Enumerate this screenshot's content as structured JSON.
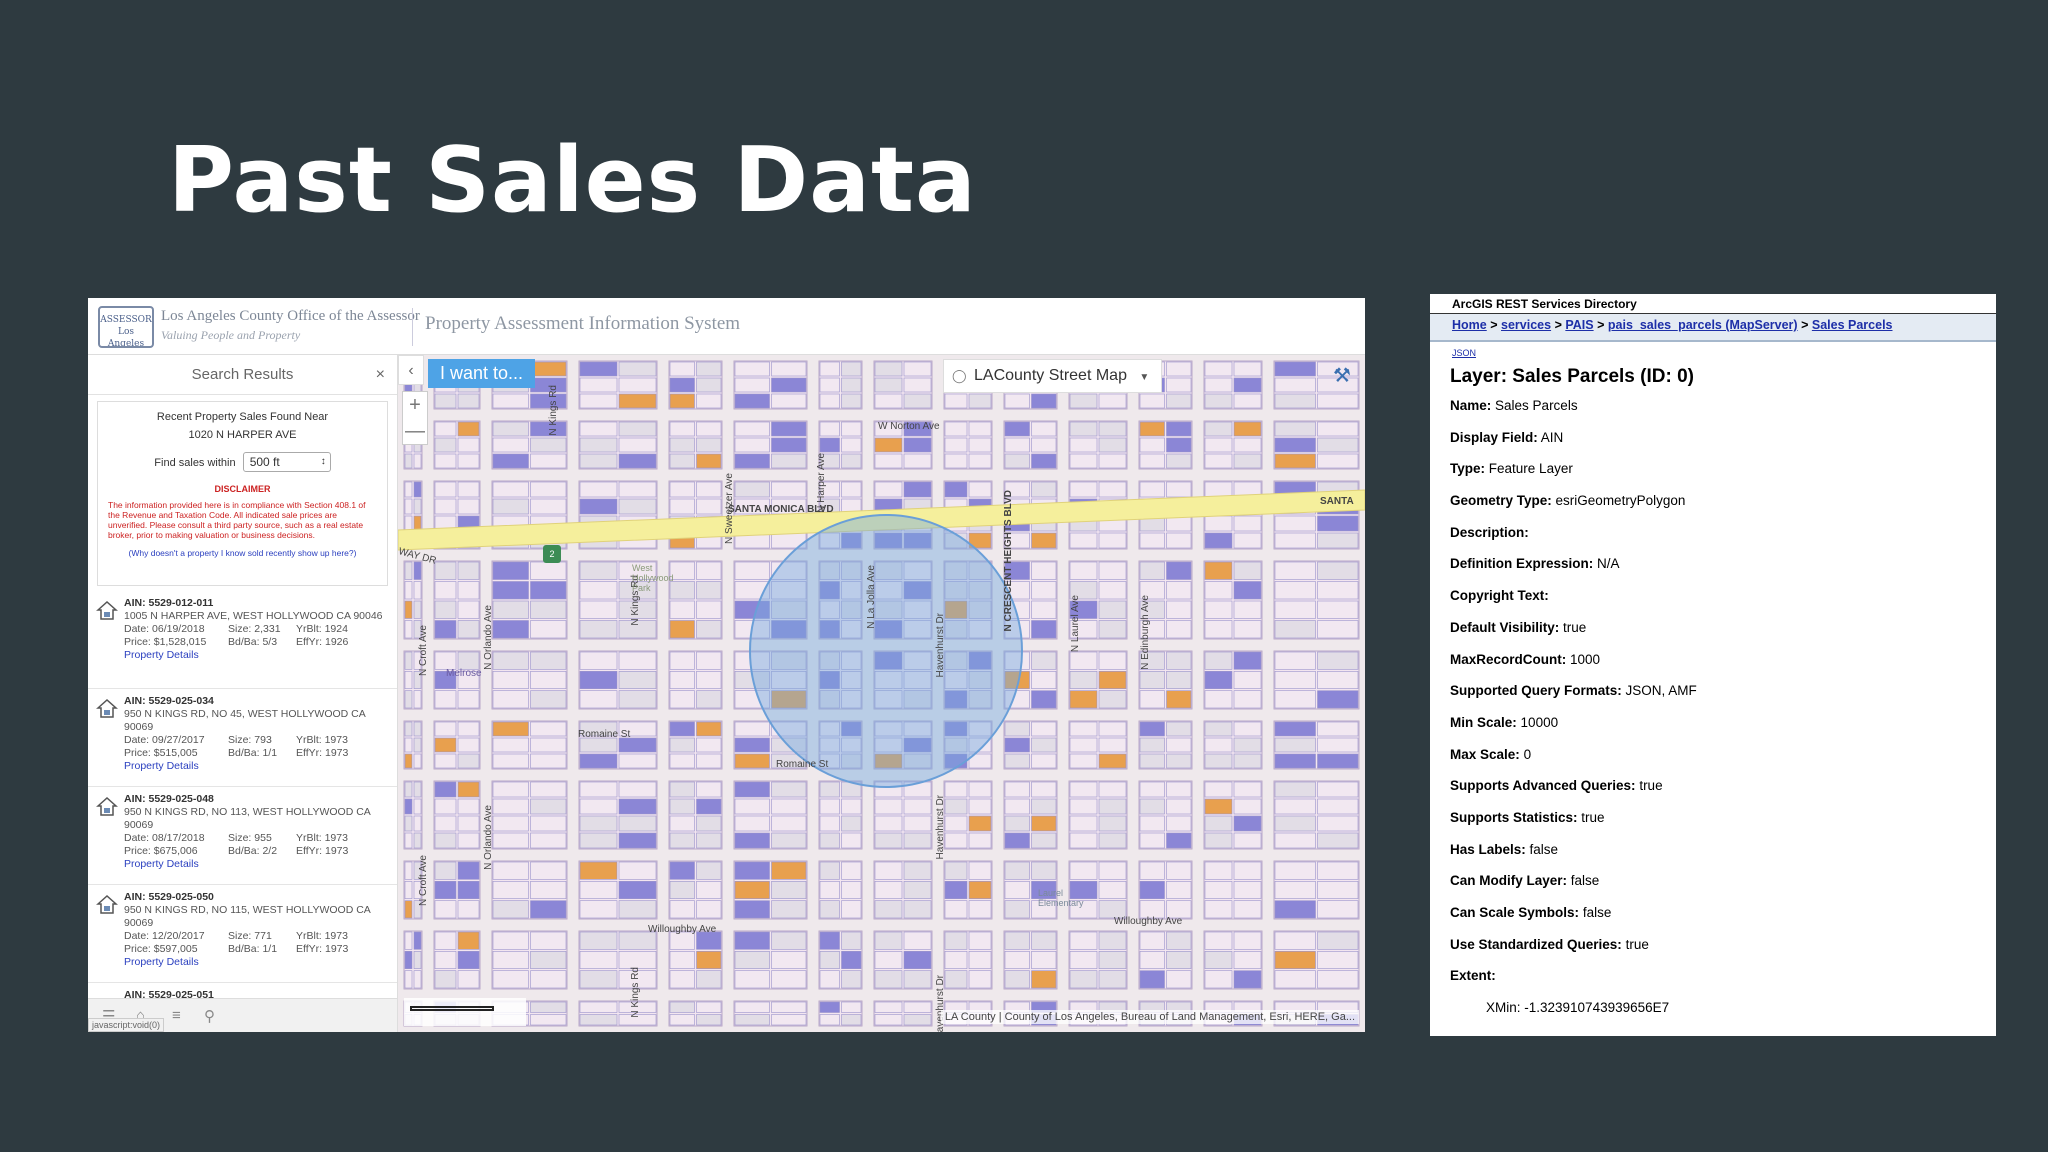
{
  "slide": {
    "title": "Past Sales Data"
  },
  "pais": {
    "logo_text": "ASSESSOR Los Angeles County",
    "office": "Los Angeles County Office of the Assessor",
    "tagline": "Valuing People and Property",
    "system_title": "Property Assessment Information System",
    "sidebar": {
      "title": "Search Results",
      "close_glyph": "×",
      "collapse_glyph": "‹",
      "recent_line1": "Recent Property Sales Found Near",
      "recent_line2": "1020 N HARPER AVE",
      "find_label": "Find sales within",
      "find_value": "500 ft",
      "disclaimer_heading": "DISCLAIMER",
      "disclaimer_text": "The information provided here is in compliance with Section 408.1 of the Revenue and Taxation Code. All indicated sale prices are unverified. Please consult a third party source, such as a real estate broker, prior to making valuation or business decisions.",
      "why_link": "(Why doesn't a property I know sold recently show up here?)",
      "results": [
        {
          "ain": "AIN: 5529-012-011",
          "address": "1005 N HARPER AVE, WEST HOLLYWOOD CA 90046",
          "date": "Date: 06/19/2018",
          "size": "Size: 2,331",
          "yrblt": "YrBlt: 1924",
          "price": "Price: $1,528,015",
          "bdba": "Bd/Ba: 5/3",
          "effyr": "EffYr: 1926",
          "link": "Property Details"
        },
        {
          "ain": "AIN: 5529-025-034",
          "address": "950 N KINGS RD, NO 45, WEST HOLLYWOOD CA 90069",
          "date": "Date: 09/27/2017",
          "size": "Size: 793",
          "yrblt": "YrBlt: 1973",
          "price": "Price: $515,005",
          "bdba": "Bd/Ba: 1/1",
          "effyr": "EffYr: 1973",
          "link": "Property Details"
        },
        {
          "ain": "AIN: 5529-025-048",
          "address": "950 N KINGS RD, NO 113, WEST HOLLYWOOD CA 90069",
          "date": "Date: 08/17/2018",
          "size": "Size: 955",
          "yrblt": "YrBlt: 1973",
          "price": "Price: $675,006",
          "bdba": "Bd/Ba: 2/2",
          "effyr": "EffYr: 1973",
          "link": "Property Details"
        },
        {
          "ain": "AIN: 5529-025-050",
          "address": "950 N KINGS RD, NO 115, WEST HOLLYWOOD CA 90069",
          "date": "Date: 12/20/2017",
          "size": "Size: 771",
          "yrblt": "YrBlt: 1973",
          "price": "Price: $597,005",
          "bdba": "Bd/Ba: 1/1",
          "effyr": "EffYr: 1973",
          "link": "Property Details"
        },
        {
          "ain": "AIN: 5529-025-051"
        }
      ],
      "status_text": "javascript:void(0)"
    },
    "map": {
      "i_want_label": "I want to...",
      "basemap_label": "LACounty Street Map",
      "zoom_in": "+",
      "zoom_out": "—",
      "attribution": "LA County | County of Los Angeles, Bureau of Land Management, Esri, HERE, Ga...",
      "route_shield": "2",
      "streets": {
        "santa_monica": "SANTA MONICA BLVD",
        "santa_right": "SANTA",
        "norton": "W Norton Ave",
        "romaine": "Romaine St",
        "romaine2": "Romaine St",
        "willoughby": "Willoughby Ave",
        "willoughby2": "Willoughby Ave",
        "kings": "N Kings Rd",
        "kings2": "N Kings Rd",
        "kings3": "N Kings Rd",
        "sweetzer": "N Sweetzer Ave",
        "harper": "N Harper Ave",
        "lajolla": "N La Jolla Ave",
        "havenhurst": "Havenhurst Dr",
        "havenhurst2": "Havenhurst Dr",
        "havenhurst3": "Havenhurst Dr",
        "crescent": "N CRESCENT HEIGHTS BLVD",
        "laurel": "N Laurel Ave",
        "edinburgh": "N Edinburgh Ave",
        "orlando": "N Orlando Ave",
        "orlando2": "N Orlando Ave",
        "croft": "N Croft Ave",
        "croft2": "N Croft Ave",
        "melrose": "Melrose",
        "way_dr": "WAY DR",
        "west_hollywood_park": "West Hollywood Park",
        "laurel_school": "Laurel Elementary"
      }
    }
  },
  "arcgis": {
    "directory_title": "ArcGIS REST Services Directory",
    "breadcrumb": [
      {
        "label": "Home"
      },
      {
        "label": "services"
      },
      {
        "label": "PAIS"
      },
      {
        "label": "pais_sales_parcels (MapServer)"
      },
      {
        "label": "Sales Parcels"
      }
    ],
    "breadcrumb_sep": ">",
    "json_link": "JSON",
    "layer_title": "Layer: Sales Parcels (ID: 0)",
    "properties": [
      {
        "key": "Name:",
        "value": "Sales Parcels"
      },
      {
        "key": "Display Field:",
        "value": "AIN"
      },
      {
        "key": "Type:",
        "value": "Feature Layer"
      },
      {
        "key": "Geometry Type:",
        "value": "esriGeometryPolygon"
      },
      {
        "key": "Description:",
        "value": ""
      },
      {
        "key": "Definition Expression:",
        "value": "N/A"
      },
      {
        "key": "Copyright Text:",
        "value": ""
      },
      {
        "key": "Default Visibility:",
        "value": "true"
      },
      {
        "key": "MaxRecordCount:",
        "value": "1000"
      },
      {
        "key": "Supported Query Formats:",
        "value": "JSON, AMF"
      },
      {
        "key": "Min Scale:",
        "value": "10000"
      },
      {
        "key": "Max Scale:",
        "value": "0"
      },
      {
        "key": "Supports Advanced Queries:",
        "value": "true"
      },
      {
        "key": "Supports Statistics:",
        "value": "true"
      },
      {
        "key": "Has Labels:",
        "value": "false"
      },
      {
        "key": "Can Modify Layer:",
        "value": "false"
      },
      {
        "key": "Can Scale Symbols:",
        "value": "false"
      },
      {
        "key": "Use Standardized Queries:",
        "value": "true"
      },
      {
        "key": "Extent:",
        "value": ""
      }
    ],
    "extent_xmin": "XMin: -1.323910743939656E7"
  }
}
